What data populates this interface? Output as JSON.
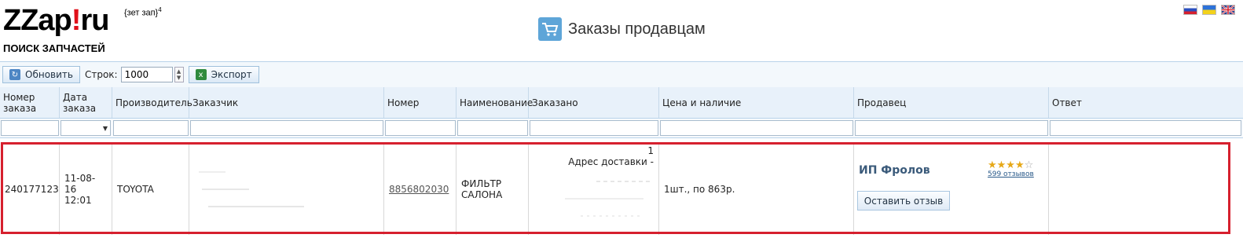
{
  "header": {
    "logo_main": "ZZap",
    "logo_bang": "!",
    "logo_tail": "ru",
    "logo_sup": "{зет зап}",
    "logo_sup_num": "4",
    "logo_sub": "ПОИСК ЗАПЧАСТЕЙ",
    "page_title": "Заказы продавцам",
    "page_icon": "cart-icon",
    "flags": [
      "ru-flag",
      "ua-flag",
      "uk-flag"
    ]
  },
  "toolbar": {
    "refresh_label": "Обновить",
    "rows_label": "Строк:",
    "rows_value": "1000",
    "export_label": "Экспорт"
  },
  "table": {
    "columns": {
      "order_no": "Номер заказа",
      "order_date": "Дата заказа",
      "manufacturer": "Производитель",
      "customer": "Заказчик",
      "part_no": "Номер",
      "name": "Наименование",
      "ordered": "Заказано",
      "price": "Цена и наличие",
      "seller": "Продавец",
      "answer": "Ответ"
    },
    "row": {
      "order_no": "240177123",
      "date": "11-08-16",
      "time": "12:01",
      "manufacturer": "TOYOTA",
      "part_no": "8856802030",
      "name_line1": "ФИЛЬТР",
      "name_line2": "САЛОНА",
      "ordered_qty": "1",
      "ordered_address": "Адрес доставки -",
      "price": "1шт., по 863р.",
      "seller_name": "ИП Фролов",
      "seller_rating": 4,
      "seller_reviews": "599 отзывов",
      "review_button": "Оставить отзыв"
    }
  },
  "colors": {
    "highlight": "#d6202e",
    "header_bg": "#e8f1fa",
    "logo_bang": "#e0101a"
  }
}
